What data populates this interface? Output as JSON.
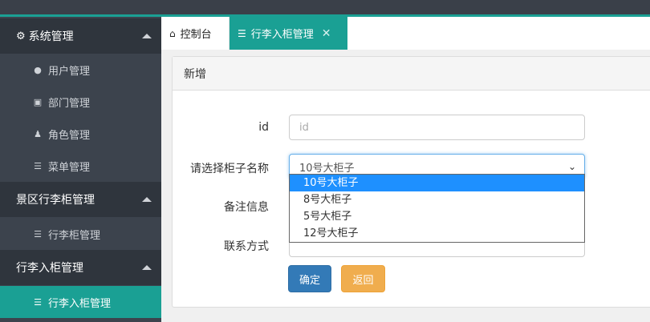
{
  "sidebar": {
    "groups": [
      {
        "label": "系统管理",
        "icon": "gear-icon",
        "items": [
          {
            "label": "用户管理",
            "icon": "user-icon"
          },
          {
            "label": "部门管理",
            "icon": "file-icon"
          },
          {
            "label": "角色管理",
            "icon": "user-secret-icon"
          },
          {
            "label": "菜单管理",
            "icon": "list-icon"
          }
        ]
      },
      {
        "label": "景区行李柜管理",
        "items": [
          {
            "label": "行李柜管理",
            "icon": "list-icon"
          }
        ]
      },
      {
        "label": "行李入柜管理",
        "items": [
          {
            "label": "行李入柜管理",
            "icon": "list-icon"
          }
        ]
      }
    ]
  },
  "tabs": [
    {
      "label": "控制台",
      "icon": "home-icon"
    },
    {
      "label": "行李入柜管理",
      "icon": "list-icon",
      "close": "✕"
    }
  ],
  "panel": {
    "title": "新增"
  },
  "form": {
    "id_label": "id",
    "id_placeholder": "id",
    "cabinet_label": "请选择柜子名称",
    "cabinet_selected": "10号大柜子",
    "cabinet_options": [
      "10号大柜子",
      "8号大柜子",
      "5号大柜子",
      "12号大柜子"
    ],
    "remark_label": "备注信息",
    "contact_label": "联系方式"
  },
  "buttons": {
    "confirm": "确定",
    "back": "返回"
  },
  "colors": {
    "accent": "#1aa094",
    "primary": "#337ab7",
    "warning": "#f0ad4e",
    "selected_option": "#1e90ff"
  }
}
